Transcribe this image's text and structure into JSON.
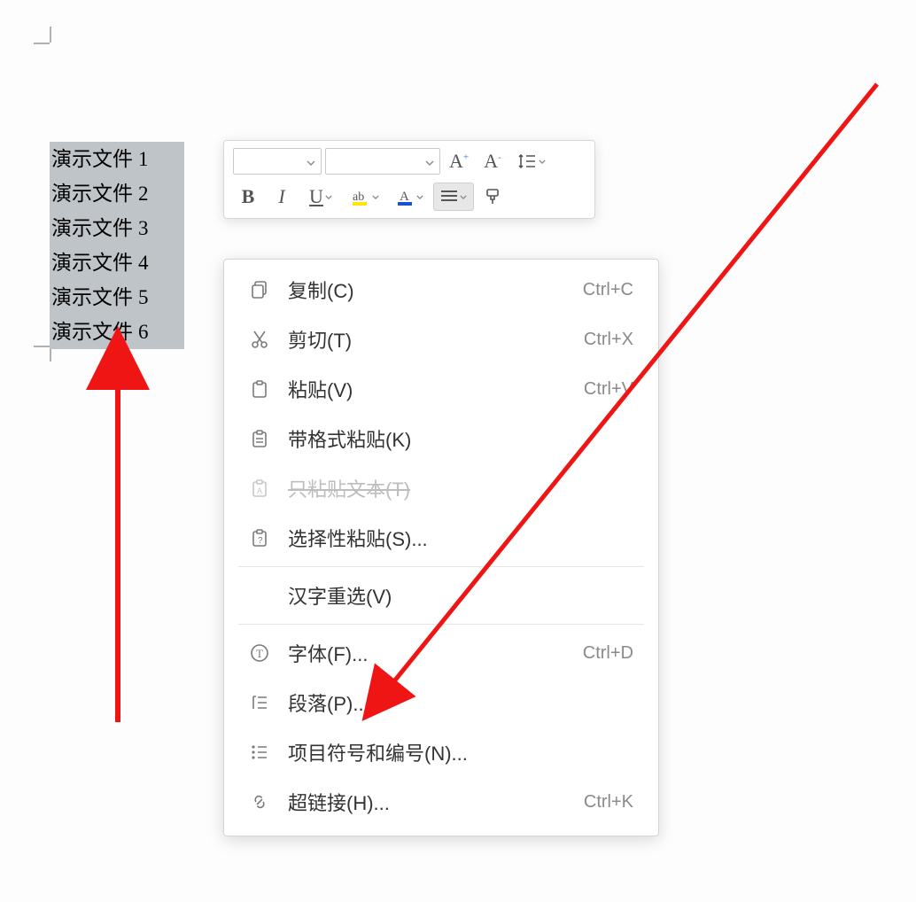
{
  "colors": {
    "arrow": "#f01515",
    "highlight": "#ffe600",
    "font_underline": "#1651d6"
  },
  "selection_lines": [
    {
      "text": "演示文件",
      "num": "1"
    },
    {
      "text": "演示文件",
      "num": "2"
    },
    {
      "text": "演示文件",
      "num": "3"
    },
    {
      "text": "演示文件",
      "num": "4"
    },
    {
      "text": "演示文件",
      "num": "5"
    },
    {
      "text": "演示文件",
      "num": "6"
    }
  ],
  "mini_toolbar": {
    "font_name": "",
    "font_size": "",
    "grow_font": "A⁺",
    "shrink_font": "A⁻",
    "bold": "B",
    "italic": "I",
    "underline": "U"
  },
  "context_menu": [
    {
      "id": "copy",
      "label": "复制(C)",
      "shortcut": "Ctrl+C",
      "icon": "copy",
      "disabled": false
    },
    {
      "id": "cut",
      "label": "剪切(T)",
      "shortcut": "Ctrl+X",
      "icon": "cut",
      "disabled": false
    },
    {
      "id": "paste",
      "label": "粘贴(V)",
      "shortcut": "Ctrl+V",
      "icon": "paste",
      "disabled": false
    },
    {
      "id": "paste-fmt",
      "label": "带格式粘贴(K)",
      "shortcut": "",
      "icon": "paste-fmt",
      "disabled": false
    },
    {
      "id": "paste-text",
      "label": "只粘贴文本(T)",
      "shortcut": "",
      "icon": "paste-text",
      "disabled": true
    },
    {
      "id": "paste-special",
      "label": "选择性粘贴(S)...",
      "shortcut": "",
      "icon": "paste-spec",
      "disabled": false
    },
    {
      "sep": true
    },
    {
      "id": "reconvert",
      "label": "汉字重选(V)",
      "shortcut": "",
      "icon": "",
      "disabled": false
    },
    {
      "sep": true
    },
    {
      "id": "font",
      "label": "字体(F)...",
      "shortcut": "Ctrl+D",
      "icon": "font",
      "disabled": false
    },
    {
      "id": "paragraph",
      "label": "段落(P)...",
      "shortcut": "",
      "icon": "paragraph",
      "disabled": false
    },
    {
      "id": "bullets",
      "label": "项目符号和编号(N)...",
      "shortcut": "",
      "icon": "bullets",
      "disabled": false
    },
    {
      "id": "hyperlink",
      "label": "超链接(H)...",
      "shortcut": "Ctrl+K",
      "icon": "link",
      "disabled": false
    }
  ]
}
